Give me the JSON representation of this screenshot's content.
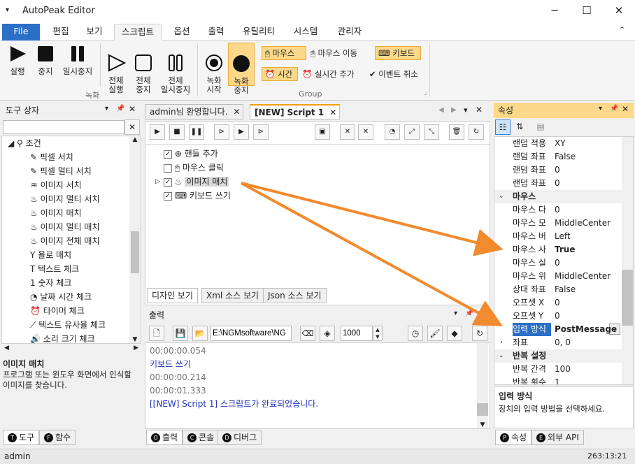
{
  "app": {
    "title": "AutoPeak Editor"
  },
  "menu": {
    "tabs": [
      "File",
      "편집",
      "보기",
      "스크립트",
      "옵션",
      "출력",
      "유틸리티",
      "시스템",
      "관리자"
    ]
  },
  "ribbon": {
    "rec": {
      "run": "실행",
      "stop": "중지",
      "pause": "일시중지",
      "run_all": "전체\n실행",
      "stop_all": "전체\n중지",
      "pause_all": "전체\n일시중지",
      "group_label": "녹화"
    },
    "rec2": {
      "rec_start": "녹화\n시작",
      "rec_stop": "녹화\n중지"
    },
    "group": {
      "mouse_label": "마우스",
      "mouse_move": "마우스 이동",
      "keyboard": "키보드",
      "time": "시간",
      "realtime_add": "실시간 추가",
      "event_cancel": "이벤트 취소",
      "group_label": "Group"
    }
  },
  "toolbox": {
    "title": "도구 상자",
    "search_placeholder": "",
    "category": "조건",
    "items": [
      "픽셀 서치",
      "픽셀 멀티 서치",
      "이미지 서치",
      "이미지 멀티 서치",
      "이미지 매치",
      "이미지 멀티 매치",
      "이미지 전체 매치",
      "욜로 매치",
      "텍스트 체크",
      "숫자 체크",
      "날짜 시간 체크",
      "타이머 체크",
      "텍스트 유사율 체크",
      "소리 크기 체크"
    ],
    "desc_title": "이미지 매치",
    "desc_text": "프로그램 또는 윈도우 화면에서 인식할 이미지를 찾습니다.",
    "bottom_tabs": [
      "도구",
      "함수"
    ]
  },
  "editor": {
    "tabs": [
      "admin님 환영합니다.",
      "[NEW] Script 1"
    ],
    "script_items": [
      "핸들 추가",
      "마우스 클릭",
      "이미지 매치",
      "키보드 쓰기"
    ],
    "view_tabs": [
      "디자인 보기",
      "Xml 소스 보기",
      "Json 소스 보기"
    ]
  },
  "output": {
    "title": "출력",
    "path": "E:\\NGMsoftware\\NG",
    "interval": "1000",
    "lines": [
      {
        "text": "00:00:00.054",
        "color": "#777"
      },
      {
        "text": "키보드 쓰기",
        "color": "#1f2fb8"
      },
      {
        "text": "00:00:00.214",
        "color": "#777"
      },
      {
        "text": "00:00:01.333",
        "color": "#777"
      },
      {
        "text": "[[NEW] Script 1] 스크립트가 완료되었습니다.",
        "color": "#1f2fb8"
      }
    ],
    "bottom_tabs": [
      "출력",
      "콘솔",
      "디버그"
    ]
  },
  "properties": {
    "title": "속성",
    "rows": [
      {
        "k": "랜덤 적용",
        "v": "XY",
        "type": "prop"
      },
      {
        "k": "랜덤 좌표",
        "v": "False",
        "type": "prop"
      },
      {
        "k": "랜덤 좌표",
        "v": "0",
        "type": "prop"
      },
      {
        "k": "랜덤 좌표",
        "v": "0",
        "type": "prop"
      },
      {
        "k": "마우스",
        "v": "",
        "type": "cat"
      },
      {
        "k": "마우스 다",
        "v": "0",
        "type": "prop"
      },
      {
        "k": "마우스 모",
        "v": "MiddleCenter",
        "type": "prop"
      },
      {
        "k": "마우스 버",
        "v": "Left",
        "type": "prop"
      },
      {
        "k": "마우스 사",
        "v": "True",
        "type": "bold"
      },
      {
        "k": "마우스 실",
        "v": "0",
        "type": "prop"
      },
      {
        "k": "마우스 위",
        "v": "MiddleCenter",
        "type": "prop"
      },
      {
        "k": "상대 좌표",
        "v": "False",
        "type": "prop"
      },
      {
        "k": "오프셋 X",
        "v": "0",
        "type": "prop"
      },
      {
        "k": "오프셋 Y",
        "v": "0",
        "type": "prop"
      },
      {
        "k": "입력 방식",
        "v": "PostMessage",
        "type": "sel"
      },
      {
        "k": "좌표",
        "v": "0, 0",
        "type": "sub"
      },
      {
        "k": "반복 설정",
        "v": "",
        "type": "cat"
      },
      {
        "k": "반복 간격",
        "v": "100",
        "type": "prop"
      },
      {
        "k": "반복 횟수",
        "v": "1",
        "type": "prop"
      }
    ],
    "desc_title": "입력 방식",
    "desc_text": "장치의 입력 방법을 선택하세요.",
    "bottom_tabs": [
      "속성",
      "외부 API"
    ]
  },
  "status": {
    "user": "admin",
    "coords": "263:13:21"
  },
  "colors": {
    "accent": "#2b6fc7",
    "highlight": "#fcd98a",
    "arrow": "#f28a2e"
  }
}
